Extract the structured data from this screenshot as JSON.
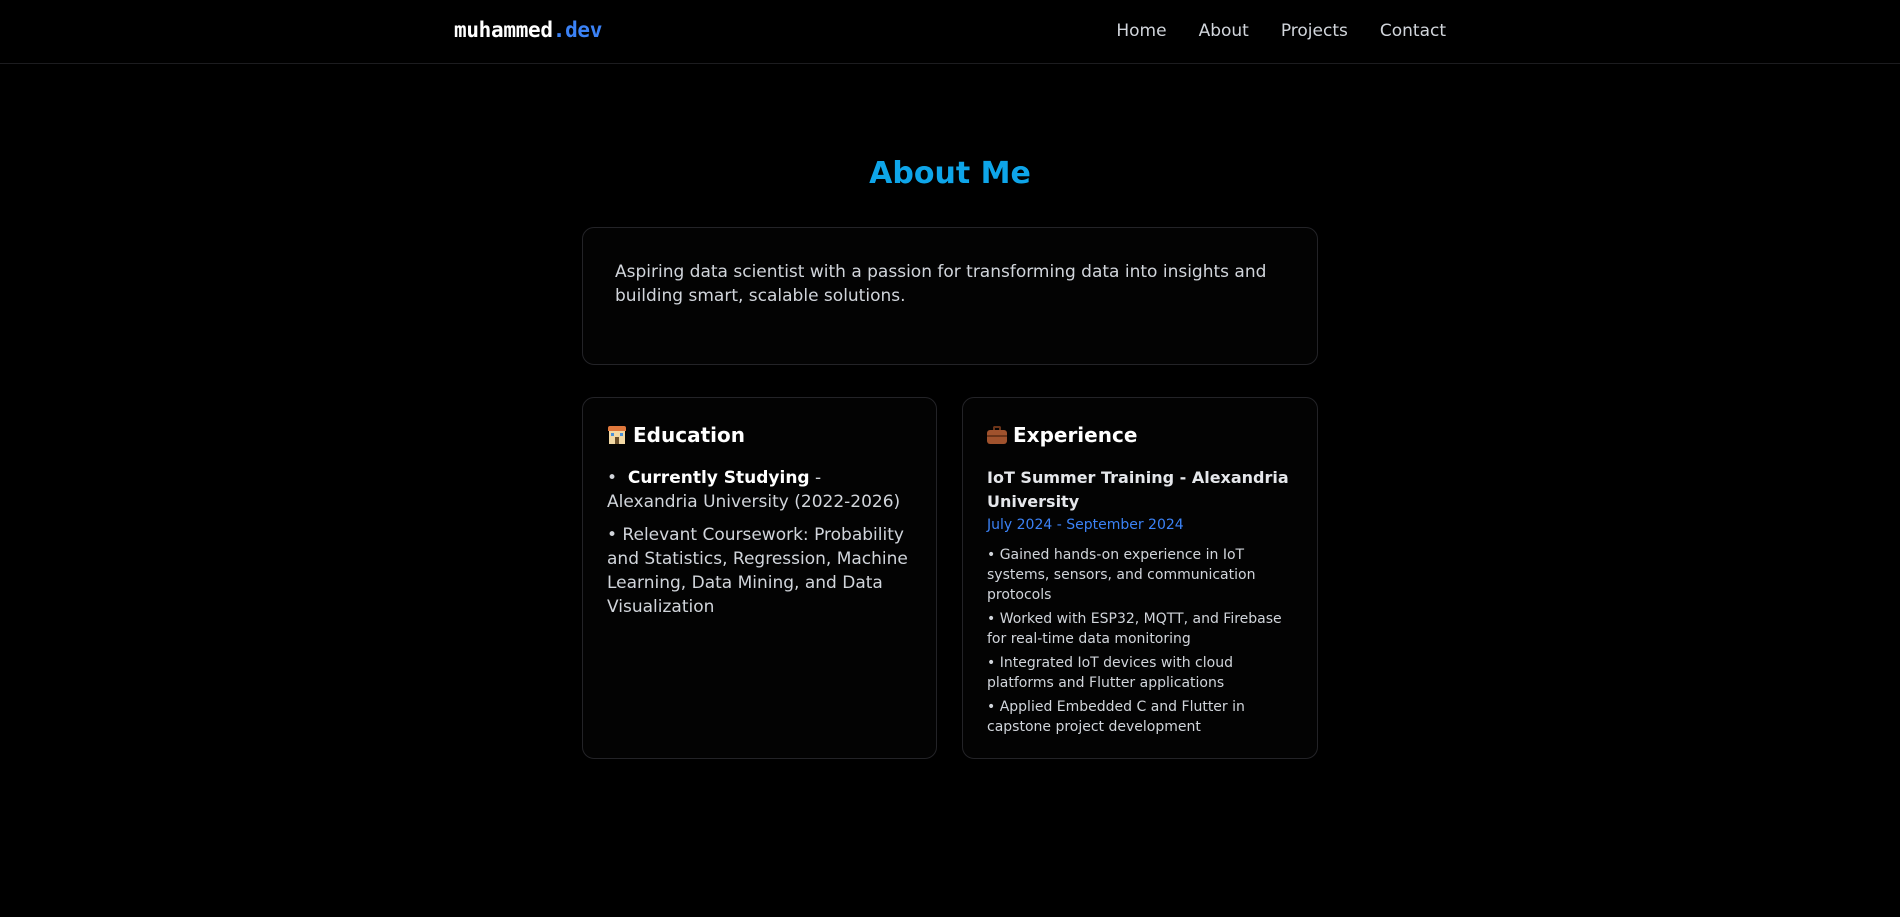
{
  "nav": {
    "logo_main": "muhammed",
    "logo_accent": ".dev",
    "links": [
      "Home",
      "About",
      "Projects",
      "Contact"
    ]
  },
  "about": {
    "title": "About Me",
    "intro": "Aspiring data scientist with a passion for transforming data into insights and building smart, scalable solutions.",
    "education": {
      "heading": "Education",
      "icon": "school-icon",
      "items": [
        {
          "bullet": "•",
          "bold": "Currently Studying",
          "text": " - Alexandria University (2022-2026)"
        },
        {
          "bullet": "•",
          "bold": "",
          "text": " Relevant Coursework: Probability and Statistics, Regression, Machine Learning, Data Mining, and Data Visualization"
        }
      ]
    },
    "experience": {
      "heading": "Experience",
      "icon": "briefcase-icon",
      "job_title": "IoT Summer Training - Alexandria University",
      "dates": "July 2024 - September 2024",
      "items": [
        "• Gained hands-on experience in IoT systems, sensors, and communication protocols",
        "• Worked with ESP32, MQTT, and Firebase for real-time data monitoring",
        "• Integrated IoT devices with cloud platforms and Flutter applications",
        "• Applied Embedded C and Flutter in capstone project development"
      ]
    }
  },
  "colors": {
    "background": "#000000",
    "accent_title": "#0ea5e9",
    "accent_blue": "#3b82f6",
    "border": "#232327"
  }
}
